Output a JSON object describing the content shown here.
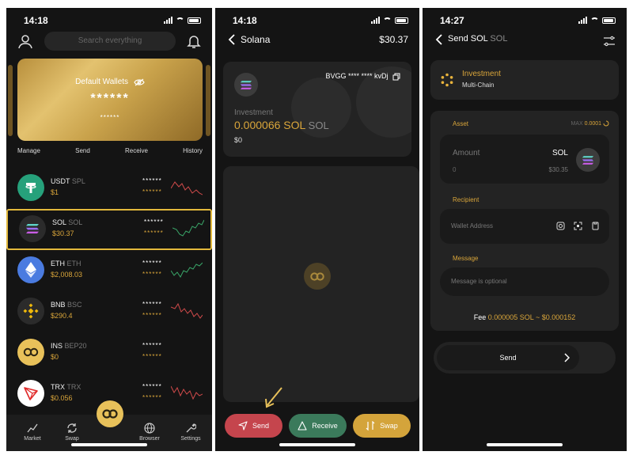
{
  "status_times": [
    "14:18",
    "14:18",
    "14:27"
  ],
  "wallet": {
    "search_placeholder": "Search everything",
    "card_title": "Default Wallets",
    "card_balance": "******",
    "card_sub": "******",
    "actions": [
      "Manage",
      "Send",
      "Receive",
      "History"
    ],
    "assets": [
      {
        "symbol": "USDT",
        "network": "SPL",
        "price": "$1",
        "s1": "******",
        "s2": "******",
        "color": "#26a17b",
        "trend": "down",
        "icon": "tether-icon"
      },
      {
        "symbol": "SOL",
        "network": "SOL",
        "price": "$30.37",
        "s1": "******",
        "s2": "******",
        "color": "#2b2b2b",
        "trend": "up",
        "icon": "solana-icon"
      },
      {
        "symbol": "ETH",
        "network": "ETH",
        "price": "$2,008.03",
        "s1": "******",
        "s2": "******",
        "color": "#4a7be0",
        "trend": "up",
        "icon": "ethereum-icon"
      },
      {
        "symbol": "BNB",
        "network": "BSC",
        "price": "$290.4",
        "s1": "******",
        "s2": "******",
        "color": "#2b2b2b",
        "trend": "down",
        "icon": "binance-icon"
      },
      {
        "symbol": "INS",
        "network": "BEP20",
        "price": "$0",
        "s1": "******",
        "s2": "******",
        "color": "#e8c15a",
        "trend": "none",
        "icon": "ins-logo-icon"
      },
      {
        "symbol": "TRX",
        "network": "TRX",
        "price": "$0.056",
        "s1": "******",
        "s2": "******",
        "color": "#ffffff",
        "trend": "down",
        "icon": "tron-icon"
      }
    ],
    "tabs": [
      "Market",
      "Swap",
      "Browser",
      "Settings"
    ]
  },
  "solana": {
    "title": "Solana",
    "balance_usd": "$30.37",
    "address": "BVGG **** **** kvDj",
    "label": "Investment",
    "amount": "0.000066 SOL",
    "amount_unit": "SOL",
    "amount_usd": "$0",
    "buttons": {
      "send": "Send",
      "receive": "Receive",
      "swap": "Swap"
    },
    "colors": {
      "send": "#c5454d",
      "receive": "#3b7a5b",
      "swap": "#d4a43b"
    }
  },
  "send": {
    "title": "Send SOL",
    "title_unit": "SOL",
    "wallet_name": "Investment",
    "wallet_type": "Multi-Chain",
    "asset_label": "Asset",
    "max_label": "MAX",
    "max_value": "0.0001",
    "amount_label": "Amount",
    "amount_value": "0",
    "currency": "SOL",
    "currency_usd": "$30.35",
    "recipient_label": "Recipient",
    "address_placeholder": "Wallet Address",
    "message_label": "Message",
    "message_placeholder": "Message is optional",
    "fee_label": "Fee",
    "fee_value": "0.000005 SOL ~ $0.000152",
    "send_button": "Send"
  }
}
